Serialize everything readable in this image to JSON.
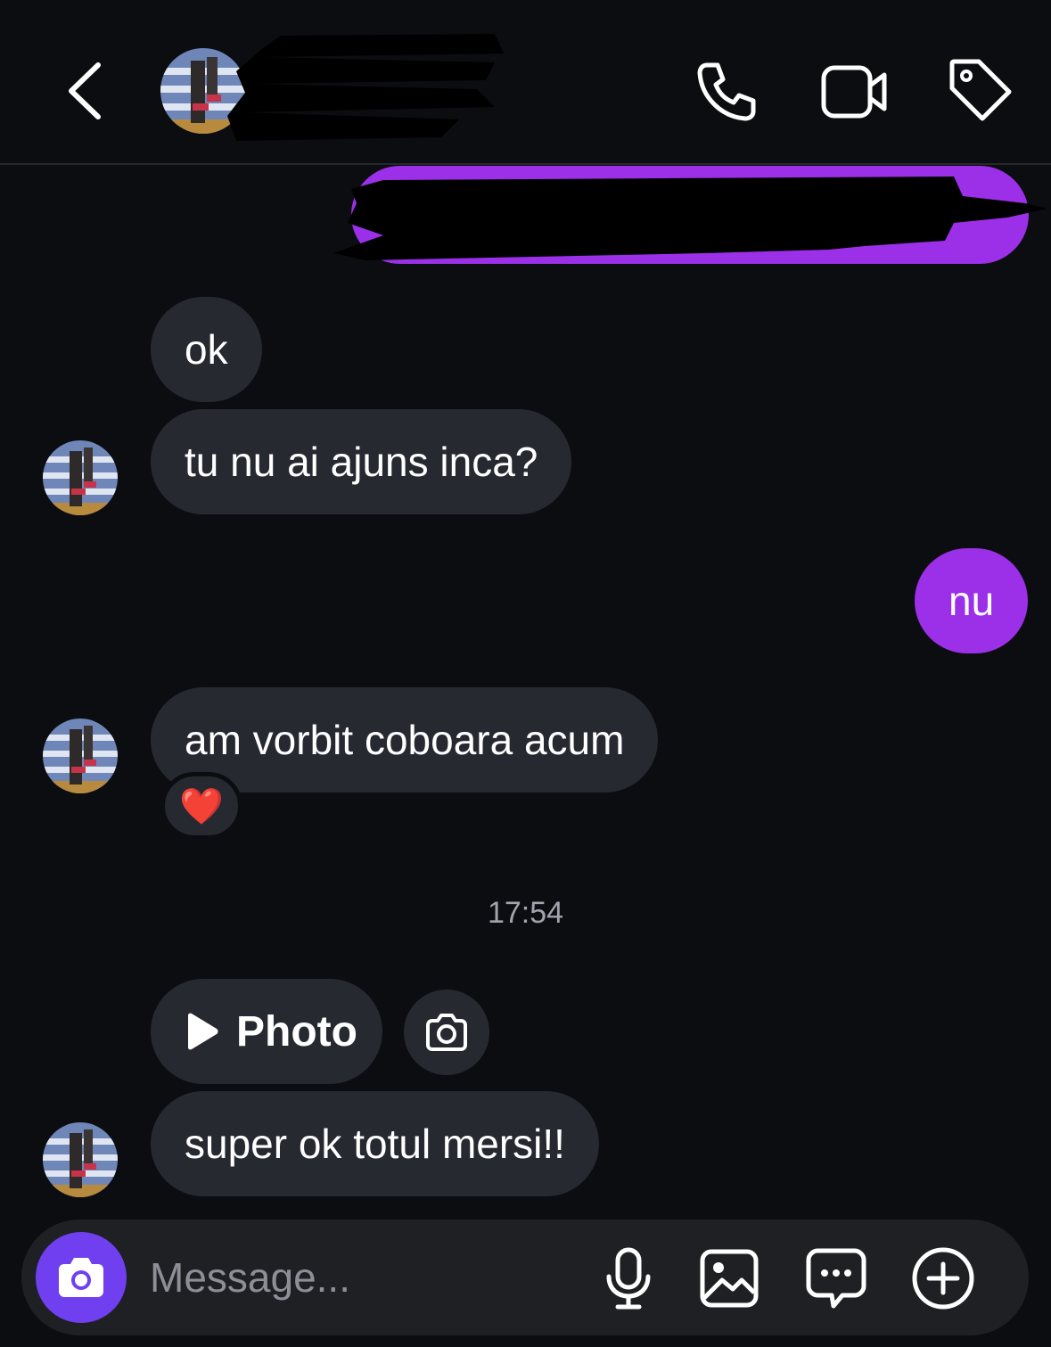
{
  "header": {
    "back_icon": "chevron-left-icon",
    "call_icon": "phone-icon",
    "video_icon": "video-camera-icon",
    "tag_icon": "tag-icon"
  },
  "messages": {
    "m1": "ok",
    "m2": "tu nu ai ajuns inca?",
    "m3": "nu",
    "m4": "am vorbit coboara acum",
    "m4_reaction": "❤️",
    "timestamp": "17:54",
    "photo_label": "Photo",
    "m5": "super ok totul mersi!!"
  },
  "composer": {
    "placeholder": "Message..."
  },
  "colors": {
    "background": "#0c0d11",
    "incoming_bubble": "#262930",
    "outgoing_bubble": "#9b30e8",
    "composer_camera": "#7040f0"
  }
}
